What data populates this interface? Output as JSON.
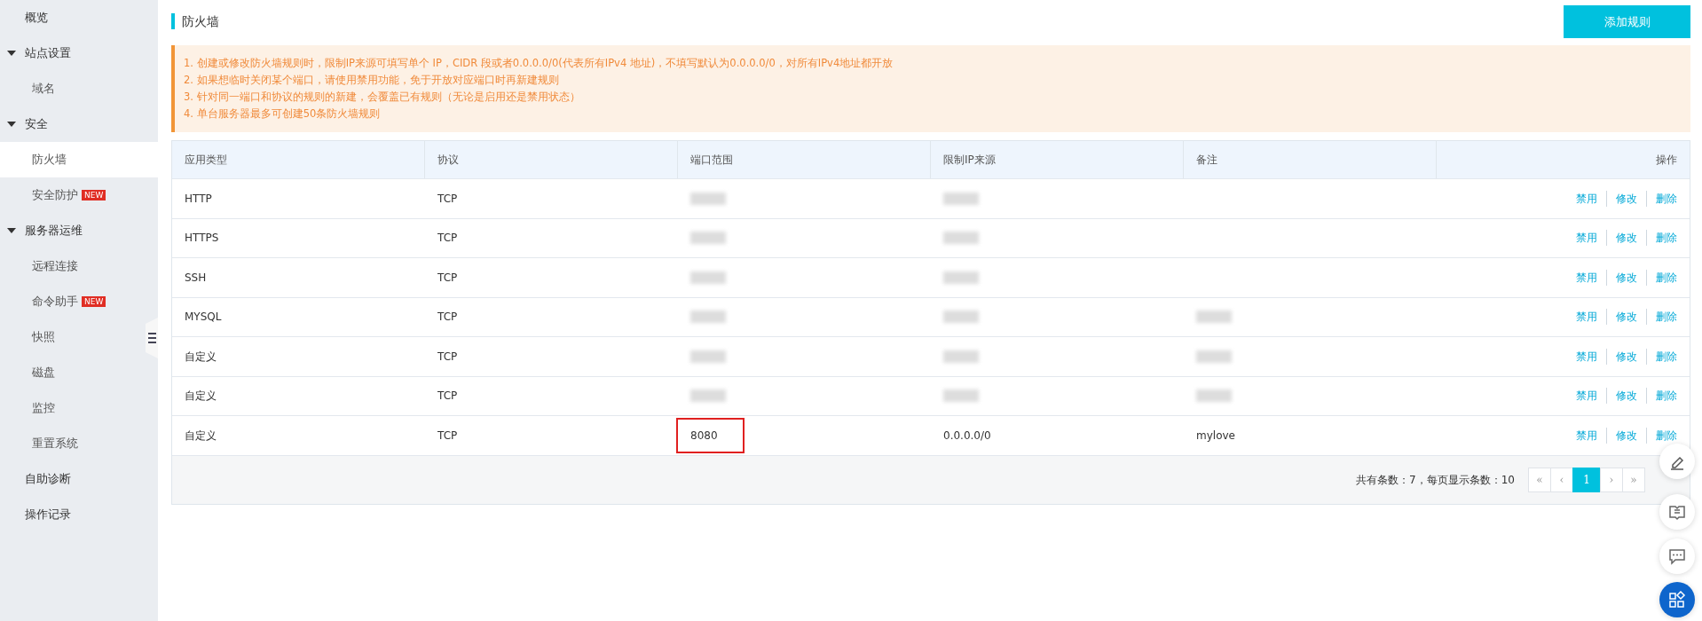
{
  "sidebar": {
    "items": [
      {
        "label": "概览",
        "selected": false
      },
      {
        "label": "站点设置",
        "expanded": true,
        "children": [
          {
            "label": "域名",
            "selected": false
          }
        ]
      },
      {
        "label": "安全",
        "expanded": true,
        "children": [
          {
            "label": "防火墙",
            "selected": true
          },
          {
            "label": "安全防护",
            "selected": false,
            "badge": "NEW"
          }
        ]
      },
      {
        "label": "服务器运维",
        "expanded": true,
        "children": [
          {
            "label": "远程连接",
            "selected": false
          },
          {
            "label": "命令助手",
            "selected": false,
            "badge": "NEW"
          },
          {
            "label": "快照",
            "selected": false
          },
          {
            "label": "磁盘",
            "selected": false
          },
          {
            "label": "监控",
            "selected": false
          },
          {
            "label": "重置系统",
            "selected": false
          }
        ]
      },
      {
        "label": "自助诊断",
        "selected": false
      },
      {
        "label": "操作记录",
        "selected": false
      }
    ]
  },
  "page": {
    "title": "防火墙",
    "add_button": "添加规则"
  },
  "notice": [
    "1. 创建或修改防火墙规则时，限制IP来源可填写单个 IP，CIDR 段或者0.0.0.0/0(代表所有IPv4 地址)，不填写默认为0.0.0.0/0，对所有IPv4地址都开放",
    "2. 如果想临时关闭某个端口，请使用禁用功能，免于开放对应端口时再新建规则",
    "3. 针对同一端口和协议的规则的新建，会覆盖已有规则（无论是启用还是禁用状态）",
    "4. 单台服务器最多可创建50条防火墙规则"
  ],
  "table": {
    "columns": [
      "应用类型",
      "协议",
      "端口范围",
      "限制IP来源",
      "备注",
      "操作"
    ],
    "rows": [
      {
        "cells": [
          {
            "text": "HTTP"
          },
          {
            "text": "TCP"
          },
          {
            "redacted": true
          },
          {
            "redacted": true
          },
          {}
        ],
        "actions": [
          "禁用",
          "修改",
          "删除"
        ]
      },
      {
        "cells": [
          {
            "text": "HTTPS"
          },
          {
            "text": "TCP"
          },
          {
            "redacted": true
          },
          {
            "redacted": true
          },
          {}
        ],
        "actions": [
          "禁用",
          "修改",
          "删除"
        ]
      },
      {
        "cells": [
          {
            "text": "SSH"
          },
          {
            "text": "TCP"
          },
          {
            "redacted": true
          },
          {
            "redacted": true
          },
          {}
        ],
        "actions": [
          "禁用",
          "修改",
          "删除"
        ]
      },
      {
        "cells": [
          {
            "text": "MYSQL"
          },
          {
            "text": "TCP"
          },
          {
            "redacted": true
          },
          {
            "redacted": true
          },
          {
            "redacted": true
          }
        ],
        "actions": [
          "禁用",
          "修改",
          "删除"
        ]
      },
      {
        "cells": [
          {
            "text": "自定义"
          },
          {
            "text": "TCP"
          },
          {
            "redacted": true
          },
          {
            "redacted": true
          },
          {
            "redacted": true
          }
        ],
        "actions": [
          "禁用",
          "修改",
          "删除"
        ]
      },
      {
        "cells": [
          {
            "text": "自定义"
          },
          {
            "text": "TCP"
          },
          {
            "redacted": true
          },
          {
            "redacted": true
          },
          {
            "redacted": true
          }
        ],
        "actions": [
          "禁用",
          "修改",
          "删除"
        ]
      },
      {
        "cells": [
          {
            "text": "自定义"
          },
          {
            "text": "TCP"
          },
          {
            "text": "8080",
            "highlighted": true
          },
          {
            "text": "0.0.0.0/0"
          },
          {
            "text": "mylove"
          }
        ],
        "actions": [
          "禁用",
          "修改",
          "删除"
        ]
      }
    ]
  },
  "pagination": {
    "summary": "共有条数：7，每页显示条数：10",
    "pages": [
      {
        "label": "«",
        "kind": "nav"
      },
      {
        "label": "‹",
        "kind": "nav"
      },
      {
        "label": "1",
        "kind": "page",
        "selected": true
      },
      {
        "label": "›",
        "kind": "nav"
      },
      {
        "label": "»",
        "kind": "nav"
      }
    ]
  },
  "float_buttons": [
    {
      "kind": "edit",
      "primary": false
    },
    {
      "kind": "book",
      "primary": false
    },
    {
      "kind": "chat",
      "primary": false
    },
    {
      "kind": "apps",
      "primary": true
    }
  ]
}
